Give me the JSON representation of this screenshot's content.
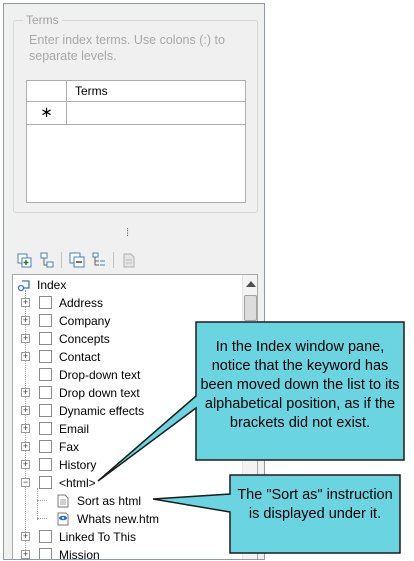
{
  "terms_group": {
    "title": "Terms",
    "instructions": "Enter index terms. Use colons (:) to separate levels.",
    "grid": {
      "column_header": "Terms",
      "new_row_marker": "∗"
    }
  },
  "splitter": "⁞",
  "toolbar": {
    "icons": [
      "add-entry-icon",
      "add-subentry-icon",
      "collapse-all-icon",
      "tree-view-icon",
      "properties-icon"
    ]
  },
  "index_tree": {
    "root": "Index",
    "items": [
      {
        "label": "Address",
        "expander": "+"
      },
      {
        "label": "Company",
        "expander": "+"
      },
      {
        "label": "Concepts",
        "expander": "+"
      },
      {
        "label": "Contact",
        "expander": "+"
      },
      {
        "label": "Drop-down text",
        "expander": ""
      },
      {
        "label": "Drop down text",
        "expander": "+"
      },
      {
        "label": "Dynamic effects",
        "expander": "+"
      },
      {
        "label": "Email",
        "expander": "+"
      },
      {
        "label": "Fax",
        "expander": "+"
      },
      {
        "label": "History",
        "expander": "+"
      },
      {
        "label": "<html>",
        "expander": "−"
      },
      {
        "label": "Linked To This",
        "expander": "+"
      },
      {
        "label": "Mission",
        "expander": "+"
      }
    ],
    "children": [
      {
        "label": "Sort as html",
        "icon": "document-icon"
      },
      {
        "label": "Whats new.htm",
        "icon": "topic-page-icon"
      }
    ]
  },
  "callouts": {
    "top": "In the Index window pane, notice that the keyword has been moved down the list to its alphabetical position, as if the brackets did not exist.",
    "bottom": "The \"Sort as\" instruction is displayed under it."
  },
  "colors": {
    "callout_fill": "#6ad5e0",
    "callout_border": "#1c1c1c"
  }
}
